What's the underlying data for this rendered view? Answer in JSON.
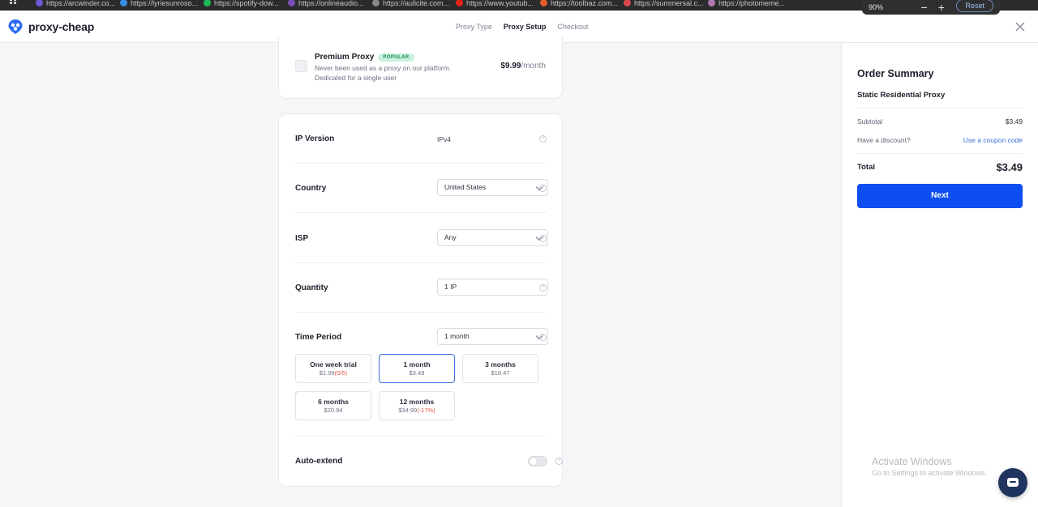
{
  "browser": {
    "bookmarks": [
      {
        "label": "https://arcwinder.co...",
        "color": "#6b5bd6"
      },
      {
        "label": "https://lyriesunroso...",
        "color": "#3a8ee6"
      },
      {
        "label": "https://spotify-dow...",
        "color": "#1db954"
      },
      {
        "label": "https://onlineaudio...",
        "color": "#7b4fb8"
      },
      {
        "label": "https://aulicite.com...",
        "color": "#888888"
      },
      {
        "label": "https://www.youtub...",
        "color": "#e62117"
      },
      {
        "label": "https://toolbaz.com...",
        "color": "#e25d2a"
      },
      {
        "label": "https://summersal.c...",
        "color": "#d84a4a"
      },
      {
        "label": "https://photomeme...",
        "color": "#b07ab0"
      }
    ],
    "zoom": {
      "level": "90%",
      "minus": "−",
      "plus": "+",
      "reset_label": "Reset"
    }
  },
  "header": {
    "brand": "proxy-cheap",
    "steps": [
      {
        "label": "Proxy Type",
        "active": false
      },
      {
        "label": "Proxy Setup",
        "active": true
      },
      {
        "label": "Checkout",
        "active": false
      }
    ]
  },
  "premium": {
    "title": "Premium Proxy",
    "badge": "POPULAR",
    "description": "Never been used as a proxy on our platform. Dedicated for a single user",
    "price": "$9.99",
    "period": "/month"
  },
  "form": {
    "ip_version": {
      "label": "IP Version",
      "value": "IPv4"
    },
    "country": {
      "label": "Country",
      "value": "United States"
    },
    "isp": {
      "label": "ISP",
      "value": "Any"
    },
    "quantity": {
      "label": "Quantity",
      "value": "1 IP"
    },
    "time_period": {
      "label": "Time Period",
      "value": "1 month",
      "options": [
        {
          "title": "One week trial",
          "price": "$1.99",
          "note": "(0/5)",
          "selected": false
        },
        {
          "title": "1 month",
          "price": "$3.49",
          "note": "",
          "selected": true
        },
        {
          "title": "3 months",
          "price": "$10.47",
          "note": "",
          "selected": false
        },
        {
          "title": "6 months",
          "price": "$20.94",
          "note": "",
          "selected": false
        },
        {
          "title": "12 months",
          "price": "$34.99",
          "note": "(-17%)",
          "selected": false
        }
      ]
    },
    "auto_extend": {
      "label": "Auto-extend",
      "enabled": false
    },
    "help_glyph": "?"
  },
  "summary": {
    "title": "Order Summary",
    "product": "Static Residential Proxy",
    "subtotal_label": "Subtotal",
    "subtotal_value": "$3.49",
    "discount_label": "Have a discount?",
    "coupon_link": "Use a coupon code",
    "total_label": "Total",
    "total_value": "$3.49",
    "next_label": "Next",
    "accent": "#0d4ef0"
  },
  "os": {
    "watermark_title": "Activate Windows",
    "watermark_sub": "Go to Settings to activate Windows."
  }
}
